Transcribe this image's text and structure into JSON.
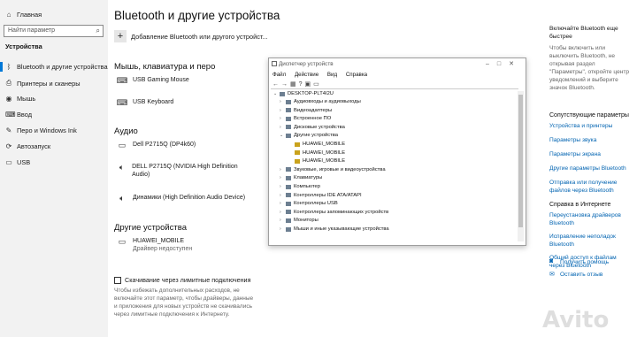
{
  "sidebar": {
    "home": "Главная",
    "search_placeholder": "Найти параметр",
    "heading": "Устройства",
    "items": [
      {
        "label": "Bluetooth и другие устройства",
        "icon": "bluetooth-icon"
      },
      {
        "label": "Принтеры и сканеры",
        "icon": "printer-icon"
      },
      {
        "label": "Мышь",
        "icon": "mouse-icon"
      },
      {
        "label": "Ввод",
        "icon": "keyboard-icon"
      },
      {
        "label": "Перо и Windows Ink",
        "icon": "pen-icon"
      },
      {
        "label": "Автозапуск",
        "icon": "autoplay-icon"
      },
      {
        "label": "USB",
        "icon": "usb-icon"
      }
    ]
  },
  "main": {
    "title": "Bluetooth и другие устройства",
    "add_device": "Добавление Bluetooth или другого устройст...",
    "sections": {
      "mouse_keyboard_pen": "Мышь, клавиатура и перо",
      "audio": "Аудио",
      "other_devices": "Другие устройства"
    },
    "mouse_devices": [
      "USB Gaming Mouse",
      "USB Keyboard"
    ],
    "audio_devices": [
      "Dell P2715Q (DP4k60)",
      "DELL P2715Q (NVIDIA High Definition Audio)",
      "Динамики (High Definition Audio Device)"
    ],
    "other_device": {
      "name": "HUAWEI_MOBILE",
      "status": "Драйвер недоступен"
    },
    "metered_checkbox": "Скачивание через лимитные подключения",
    "metered_text": "Чтобы избежать дополнительных расходов, не включайте этот параметр, чтобы драйверы, данные и приложения для новых устройств не скачивались через лимитные подключения к Интернету."
  },
  "device_manager": {
    "title": "Диспетчер устройств",
    "menu": [
      "Файл",
      "Действие",
      "Вид",
      "Справка"
    ],
    "root": "DESKTOP-PLT4I2U",
    "tree": [
      {
        "label": "Аудиовходы и аудиовыходы",
        "level": 1,
        "expanded": false
      },
      {
        "label": "Видеоадаптеры",
        "level": 1,
        "expanded": false
      },
      {
        "label": "Встроенное ПО",
        "level": 1,
        "expanded": false
      },
      {
        "label": "Дисковые устройства",
        "level": 1,
        "expanded": false
      },
      {
        "label": "Другие устройства",
        "level": 1,
        "expanded": true
      },
      {
        "label": "HUAWEI_MOBILE",
        "level": 2,
        "warn": true
      },
      {
        "label": "HUAWEI_MOBILE",
        "level": 2,
        "warn": true
      },
      {
        "label": "HUAWEI_MOBILE",
        "level": 2,
        "warn": true
      },
      {
        "label": "Звуковые, игровые и видеоустройства",
        "level": 1,
        "expanded": false
      },
      {
        "label": "Клавиатуры",
        "level": 1,
        "expanded": false
      },
      {
        "label": "Компьютер",
        "level": 1,
        "expanded": false
      },
      {
        "label": "Контроллеры IDE ATA/ATAPI",
        "level": 1,
        "expanded": false
      },
      {
        "label": "Контроллеры USB",
        "level": 1,
        "expanded": false
      },
      {
        "label": "Контроллеры запоминающих устройств",
        "level": 1,
        "expanded": false
      },
      {
        "label": "Мониторы",
        "level": 1,
        "expanded": false
      },
      {
        "label": "Мыши и иные указывающие устройства",
        "level": 1,
        "expanded": false
      }
    ]
  },
  "right_panel": {
    "bt_tip": "Включайте Bluetooth еще быстрее",
    "bt_tip_text": "Чтобы включить или выключить Bluetooth, не открывая раздел \"Параметры\", откройте центр уведомлений и выберите значок Bluetooth.",
    "related_heading": "Сопутствующие параметры",
    "related_links": [
      "Устройства и принтеры",
      "Параметры звука",
      "Параметры экрана",
      "Другие параметры Bluetooth",
      "Отправка или получение файлов через Bluetooth"
    ],
    "help_heading": "Справка в Интернете",
    "help_links": [
      "Переустановка драйверов Bluetooth",
      "Исправление неполадок Bluetooth",
      "Общий доступ к файлам через Bluetooth"
    ],
    "get_help": "Получить помощь",
    "feedback": "Оставить отзыв"
  },
  "watermark": "Avito"
}
